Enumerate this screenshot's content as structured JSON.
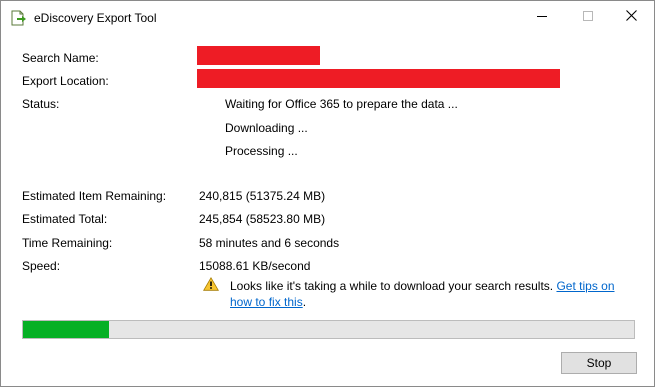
{
  "window": {
    "title": "eDiscovery Export Tool",
    "controls": [
      "minimize-icon",
      "maximize-icon",
      "close-icon"
    ]
  },
  "fields": {
    "search_name_label": "Search Name:",
    "export_location_label": "Export Location:",
    "status_label": "Status:",
    "status_lines": [
      "Waiting for Office 365 to prepare the data ...",
      "Downloading ...",
      "Processing ..."
    ],
    "estimated_item_remaining_label": "Estimated Item Remaining:",
    "estimated_item_remaining_value": "240,815 (51375.24 MB)",
    "estimated_total_label": "Estimated Total:",
    "estimated_total_value": "245,854 (58523.80 MB)",
    "time_remaining_label": "Time Remaining:",
    "time_remaining_value": "58 minutes and 6 seconds",
    "speed_label": "Speed:",
    "speed_value": "15088.61 KB/second"
  },
  "notice": {
    "text": "Looks like it's taking a while to download your search results. ",
    "link": "Get tips on how to fix this",
    "suffix": ".",
    "icon": "warning-icon"
  },
  "progress": {
    "fraction": 0.14,
    "fill_color": "#06b025"
  },
  "buttons": {
    "stop_label": "Stop"
  },
  "colors": {
    "redaction": "#ee1c25",
    "link": "#0066cc"
  }
}
